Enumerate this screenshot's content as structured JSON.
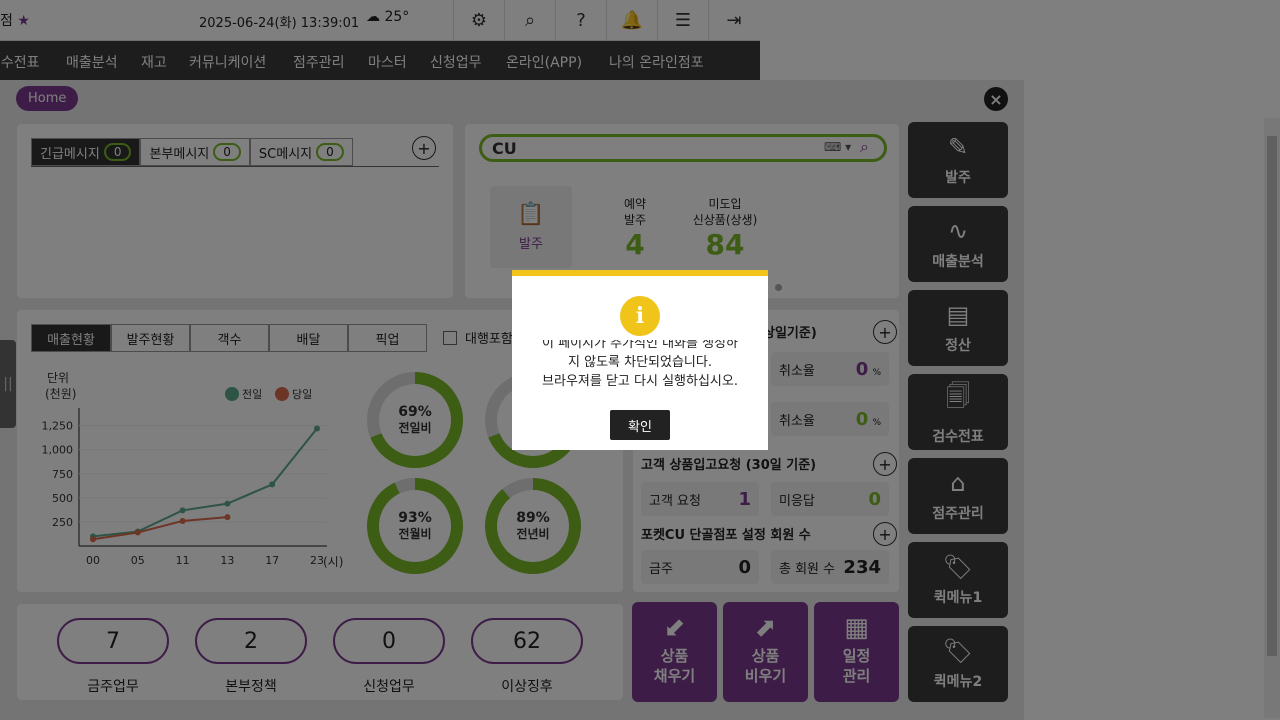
{
  "topbar": {
    "store_name": "점",
    "datetime": "2025-06-24(화) 13:39:01",
    "temperature": "25°",
    "icons": [
      "gear-icon",
      "search-icon",
      "help-icon",
      "bell-icon",
      "menu-icon",
      "logout-icon"
    ]
  },
  "nav": {
    "items": [
      "검수전표",
      "매출분석",
      "재고",
      "커뮤니케이션",
      "점주관리",
      "마스터",
      "신청업무",
      "온라인(APP)",
      "나의 온라인점포"
    ]
  },
  "breadcrumb": "Home",
  "messages": {
    "tabs": [
      {
        "label": "긴급메시지",
        "count": "0"
      },
      {
        "label": "본부메시지",
        "count": "0"
      },
      {
        "label": "SC메시지",
        "count": "0"
      }
    ]
  },
  "search": {
    "brand": "CU"
  },
  "order_summary": {
    "order_label": "발주",
    "reserved_label1": "예약",
    "reserved_label2": "발주",
    "reserved_value": "4",
    "new_label1": "미도입",
    "new_label2": "신상품(상생)",
    "new_value": "84"
  },
  "sales_tabs": [
    "매출현황",
    "발주현황",
    "객수",
    "배달",
    "픽업"
  ],
  "proxy_checkbox": "대행포함",
  "chart_data": {
    "type": "line",
    "unit_label1": "단위",
    "unit_label2": "(천원)",
    "x": [
      "00",
      "05",
      "11",
      "13",
      "17",
      "23"
    ],
    "xlabel": "(시)",
    "y_ticks": [
      "1,250",
      "1,000",
      "750",
      "500",
      "250"
    ],
    "ylim": [
      0,
      1350
    ],
    "series": [
      {
        "name": "전일",
        "color": "#5aa88a",
        "values": [
          100,
          150,
          370,
          440,
          640,
          1220
        ]
      },
      {
        "name": "당일",
        "color": "#d96a4a",
        "values": [
          70,
          140,
          260,
          300,
          null,
          null
        ]
      }
    ]
  },
  "donuts": [
    {
      "pct": "69%",
      "label": "전일비",
      "value": 69
    },
    {
      "pct": "93%",
      "label": "전월비",
      "value": 93
    },
    {
      "pct": "89%",
      "label": "전년비",
      "value": 89
    }
  ],
  "stats": {
    "base_suffix": "상일기준)",
    "cancel_label": "취소율",
    "cancel1": "0",
    "cancel2": "0",
    "pct": "%",
    "customer_title": "고객 상품입고요청 (30일 기준)",
    "cust_req_label": "고객 요청",
    "cust_req": "1",
    "unanswered_label": "미응답",
    "unanswered": "0",
    "pocket_title": "포켓CU 단골점포 설정 회원 수",
    "today_label": "금주",
    "today": "0",
    "total_label": "총 회원 수",
    "total": "234"
  },
  "tasks": [
    {
      "value": "7",
      "label": "금주업무"
    },
    {
      "value": "2",
      "label": "본부정책"
    },
    {
      "value": "0",
      "label": "신청업무"
    },
    {
      "value": "62",
      "label": "이상징후"
    }
  ],
  "purple_buttons": [
    {
      "l1": "상품",
      "l2": "채우기"
    },
    {
      "l1": "상품",
      "l2": "비우기"
    },
    {
      "l1": "일정",
      "l2": "관리"
    }
  ],
  "quick_menu": [
    "발주",
    "매출분석",
    "정산",
    "검수전표",
    "점주관리",
    "퀵메뉴",
    "퀵메뉴"
  ],
  "quick_menu_nums": [
    "1",
    "2"
  ],
  "modal": {
    "line1": "이 페이지가 추가적인 대화를 생성하",
    "line2": "지 않도록 차단되었습니다.",
    "line3": "브라우져를 닫고 다시 실행하십시오.",
    "ok": "확인"
  }
}
